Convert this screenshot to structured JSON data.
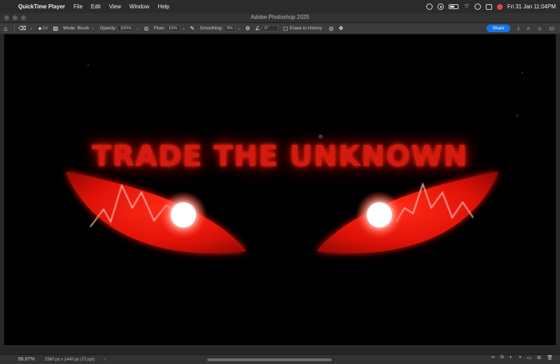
{
  "menubar": {
    "app_name": "QuickTime Player",
    "items": [
      "File",
      "Edit",
      "View",
      "Window",
      "Help"
    ],
    "clock": "Fri 31 Jan  11:04PM"
  },
  "window": {
    "title": "Adobe Photoshop 2025"
  },
  "options": {
    "brush_size": "150",
    "mode_label": "Mode:",
    "mode_value": "Brush",
    "opacity_label": "Opacity:",
    "opacity_value": "100%",
    "flow_label": "Flow:",
    "flow_value": "15%",
    "smoothing_label": "Smoothing:",
    "smoothing_value": "0%",
    "angle_value": "0°",
    "erase_history_label": "Erase to History",
    "share_label": "Share"
  },
  "canvas": {
    "headline": "TRADE THE UNKNOWN",
    "background": "#000000",
    "accent": "#d41a10"
  },
  "status": {
    "zoom": "66.67%",
    "doc_info": "2560 px x 1440 px (72 ppi)"
  },
  "colors": {
    "share": "#1473e6",
    "record": "#e04848"
  },
  "icons": [
    "apple-icon",
    "home-icon",
    "eraser-icon",
    "brush-preset-icon",
    "toggle-brush-panel-icon",
    "airbrush-icon",
    "gear-icon",
    "angle-icon",
    "pressure-icon",
    "symmetry-icon",
    "bell-icon",
    "search-icon",
    "lightbulb-icon",
    "workspace-icon"
  ]
}
